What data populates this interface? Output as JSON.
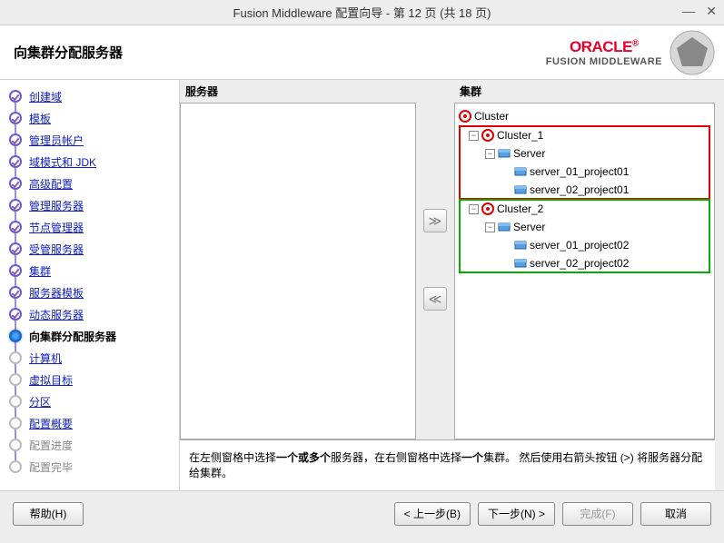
{
  "window": {
    "title": "Fusion Middleware 配置向导 - 第 12 页 (共 18 页)"
  },
  "header": {
    "title": "向集群分配服务器",
    "brand_main": "ORACLE",
    "brand_sub": "FUSION MIDDLEWARE"
  },
  "nav": [
    {
      "label": "创建域",
      "state": "done"
    },
    {
      "label": "模板",
      "state": "done"
    },
    {
      "label": "管理员帐户",
      "state": "done"
    },
    {
      "label": "域模式和 JDK",
      "state": "done"
    },
    {
      "label": "高级配置",
      "state": "done"
    },
    {
      "label": "管理服务器",
      "state": "done"
    },
    {
      "label": "节点管理器",
      "state": "done"
    },
    {
      "label": "受管服务器",
      "state": "done"
    },
    {
      "label": "集群",
      "state": "done"
    },
    {
      "label": "服务器模板",
      "state": "done"
    },
    {
      "label": "动态服务器",
      "state": "done"
    },
    {
      "label": "向集群分配服务器",
      "state": "current"
    },
    {
      "label": "计算机",
      "state": "future"
    },
    {
      "label": "虚拟目标",
      "state": "future"
    },
    {
      "label": "分区",
      "state": "future"
    },
    {
      "label": "配置概要",
      "state": "future"
    },
    {
      "label": "配置进度",
      "state": "disabled"
    },
    {
      "label": "配置完毕",
      "state": "disabled"
    }
  ],
  "panels": {
    "left_label": "服务器",
    "right_label": "集群"
  },
  "tree": {
    "root": "Cluster",
    "clusters": [
      {
        "name": "Cluster_1",
        "highlight": "red",
        "group": "Server",
        "servers": [
          "server_01_project01",
          "server_02_project01"
        ]
      },
      {
        "name": "Cluster_2",
        "highlight": "green",
        "group": "Server",
        "servers": [
          "server_01_project02",
          "server_02_project02"
        ]
      }
    ]
  },
  "hint": {
    "p1": "在左侧窗格中选择",
    "b1": "一个或多个",
    "p2": "服务器，在右侧窗格中选择",
    "b2": "一个",
    "p3": "集群。 然后使用右箭头按钮 (>) 将服务器分配给集群。"
  },
  "footer": {
    "help": "帮助(H)",
    "back": "< 上一步(B)",
    "next": "下一步(N) >",
    "finish": "完成(F)",
    "cancel": "取消"
  },
  "arrows": {
    "right": "≫",
    "left": "≪"
  }
}
